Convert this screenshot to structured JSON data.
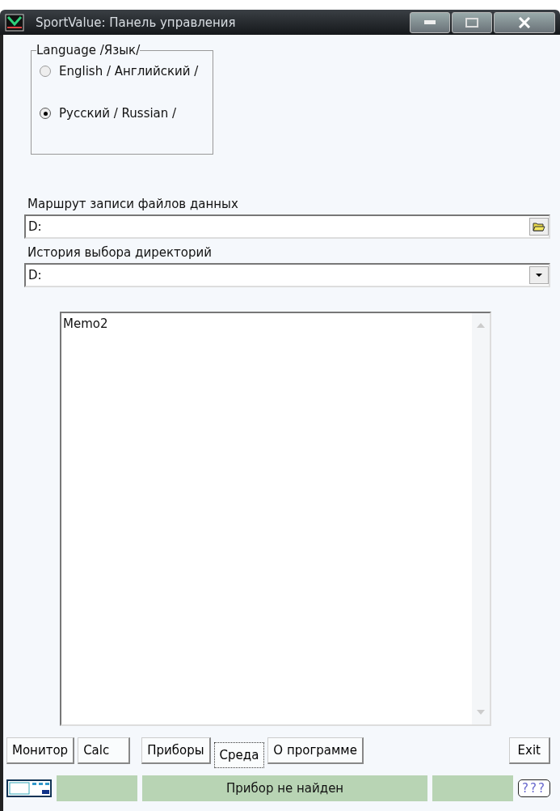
{
  "window": {
    "title": "SportValue: Панель управления"
  },
  "language": {
    "legend": "Language /Язык/",
    "options": [
      {
        "label": "English  / Английский /",
        "selected": false
      },
      {
        "label": "Русский  / Russian /",
        "selected": true
      }
    ]
  },
  "data_path": {
    "label": "Маршрут записи файлов данных",
    "value": "D:"
  },
  "history": {
    "label": "История выбора директорий",
    "value": "D:"
  },
  "memo": {
    "value": "Memo2"
  },
  "tabs": [
    {
      "label": "Монитор",
      "selected": false
    },
    {
      "label": "Calc",
      "selected": false
    },
    {
      "label": "Приборы",
      "selected": false
    },
    {
      "label": "Среда",
      "selected": true
    },
    {
      "label": "О программе",
      "selected": false
    }
  ],
  "exit_button": "Exit",
  "status_bar": {
    "message": "Прибор не найден",
    "help": "???"
  }
}
